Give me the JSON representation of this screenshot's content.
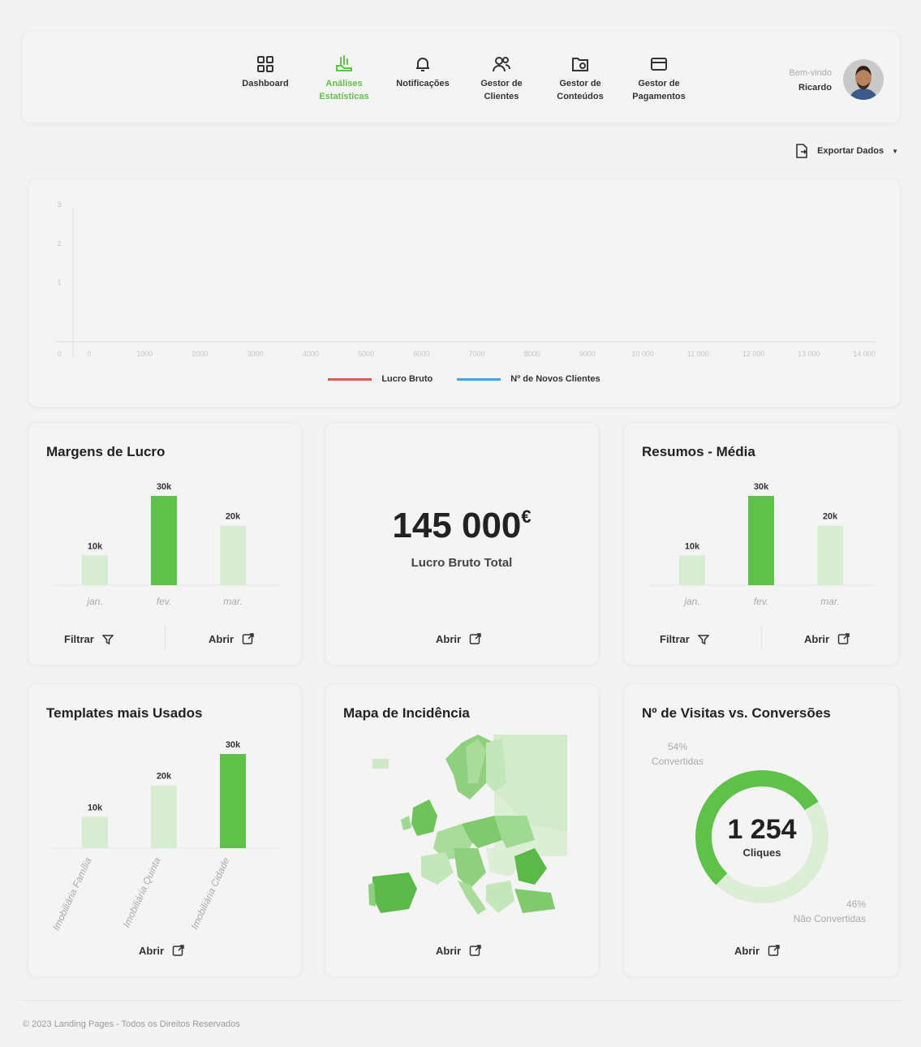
{
  "nav": {
    "items": [
      {
        "label": "Dashboard",
        "icon": "grid-icon",
        "active": false
      },
      {
        "label": "Análises Estatísticas",
        "icon": "chart-hand-icon",
        "active": true
      },
      {
        "label": "Notificações",
        "icon": "bell-icon",
        "active": false
      },
      {
        "label": "Gestor de Clientes",
        "icon": "users-icon",
        "active": false
      },
      {
        "label": "Gestor de Conteúdos",
        "icon": "folder-gear-icon",
        "active": false
      },
      {
        "label": "Gestor de Pagamentos",
        "icon": "card-icon",
        "active": false
      }
    ],
    "greeting": "Bem-vindo",
    "username": "Ricardo"
  },
  "export": {
    "label": "Exportar Dados"
  },
  "main_chart": {
    "legend": [
      {
        "label": "Lucro Bruto",
        "color": "#e05a4f"
      },
      {
        "label": "Nº de Novos Clientes",
        "color": "#4aa3e0"
      }
    ]
  },
  "margins": {
    "title": "Margens de Lucro",
    "filter_label": "Filtrar",
    "open_label": "Abrir"
  },
  "total": {
    "value": "145 000",
    "currency": "€",
    "label": "Lucro Bruto Total",
    "open_label": "Abrir"
  },
  "summary": {
    "title": "Resumos - Média",
    "filter_label": "Filtrar",
    "open_label": "Abrir"
  },
  "templates": {
    "title": "Templates mais Usados",
    "open_label": "Abrir"
  },
  "map": {
    "title": "Mapa de Incidência",
    "open_label": "Abrir"
  },
  "visits": {
    "title": "Nº de Visitas vs. Conversões",
    "center_value": "1 254",
    "center_label": "Cliques",
    "converted_pct": "54%",
    "converted_label": "Convertidas",
    "not_converted_pct": "46%",
    "not_converted_label": "Não Convertidas",
    "open_label": "Abrir"
  },
  "footer": {
    "text": "© 2023 Landing Pages - Todos os Direitos Reservados"
  },
  "colors": {
    "accent": "#5fc14a",
    "light_bar": "#d8ecd2",
    "donut_light": "#dcefd6"
  },
  "chart_data": [
    {
      "type": "line",
      "x": [
        0,
        1000,
        2000,
        3000,
        4000,
        5000,
        6000,
        7000,
        8000,
        9000,
        10000,
        11000,
        12000,
        13000,
        14000
      ],
      "xticks": [
        "0",
        "1000",
        "2000",
        "3000",
        "4000",
        "5000",
        "6000",
        "7000",
        "8000",
        "9000",
        "10 000",
        "11 000",
        "12 000",
        "13 000",
        "14 000"
      ],
      "yticks": [
        "0",
        "1",
        "2",
        "3"
      ],
      "ylim": [
        0,
        3
      ],
      "series": [
        {
          "name": "Lucro Bruto",
          "values": []
        },
        {
          "name": "Nº de Novos Clientes",
          "values": []
        }
      ]
    },
    {
      "type": "bar",
      "title": "Margens de Lucro",
      "categories": [
        "jan.",
        "fev.",
        "mar."
      ],
      "values": [
        10000,
        30000,
        20000
      ],
      "labels": [
        "10k",
        "30k",
        "20k"
      ],
      "highlight": 1
    },
    {
      "type": "bar",
      "title": "Resumos - Média",
      "categories": [
        "jan.",
        "fev.",
        "mar."
      ],
      "values": [
        10000,
        30000,
        20000
      ],
      "labels": [
        "10k",
        "30k",
        "20k"
      ],
      "highlight": 1
    },
    {
      "type": "bar",
      "title": "Templates mais Usados",
      "categories": [
        "Imobiliária Família",
        "Imobiliária Quinta",
        "Imobiliária Cidade"
      ],
      "values": [
        10000,
        20000,
        30000
      ],
      "labels": [
        "10k",
        "20k",
        "30k"
      ],
      "highlight": 2
    },
    {
      "type": "pie",
      "title": "Nº de Visitas vs. Conversões",
      "categories": [
        "Convertidas",
        "Não Convertidas"
      ],
      "values": [
        54,
        46
      ]
    }
  ]
}
